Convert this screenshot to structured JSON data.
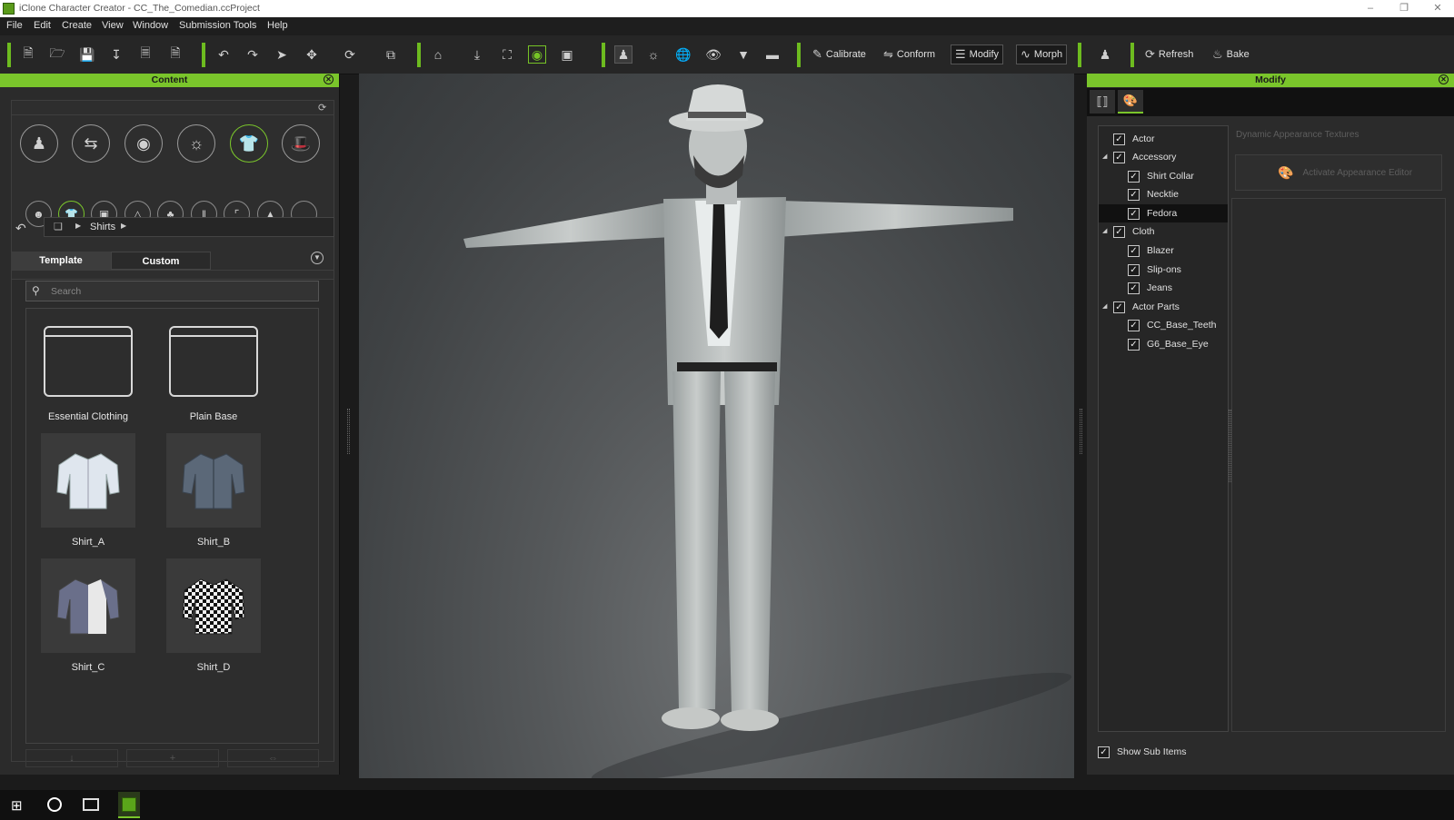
{
  "window": {
    "title": "iClone Character Creator - CC_The_Comedian.ccProject"
  },
  "menu": [
    "File",
    "Edit",
    "Create",
    "View",
    "Window",
    "Submission Tools",
    "Help"
  ],
  "toolbar": {
    "calibrate": "Calibrate",
    "conform": "Conform",
    "modify": "Modify",
    "morph": "Morph",
    "refresh": "Refresh",
    "bake": "Bake"
  },
  "content": {
    "title": "Content",
    "breadcrumb": "Shirts",
    "tabs": [
      "Template",
      "Custom"
    ],
    "search_placeholder": "Search",
    "items": [
      {
        "label": "Essential Clothing",
        "type": "folder"
      },
      {
        "label": "Plain Base",
        "type": "folder"
      },
      {
        "label": "Shirt_A",
        "type": "shirt"
      },
      {
        "label": "Shirt_B",
        "type": "shirt"
      },
      {
        "label": "Shirt_C",
        "type": "shirt"
      },
      {
        "label": "Shirt_D",
        "type": "shirt"
      }
    ]
  },
  "modify": {
    "title": "Modify",
    "tree": [
      {
        "label": "Actor",
        "level": 0,
        "checked": true
      },
      {
        "label": "Accessory",
        "level": 0,
        "checked": true,
        "expand": true
      },
      {
        "label": "Shirt Collar",
        "level": 1,
        "checked": true
      },
      {
        "label": "Necktie",
        "level": 1,
        "checked": true
      },
      {
        "label": "Fedora",
        "level": 1,
        "checked": true,
        "selected": true
      },
      {
        "label": "Cloth",
        "level": 0,
        "checked": true,
        "expand": true
      },
      {
        "label": "Blazer",
        "level": 1,
        "checked": true
      },
      {
        "label": "Slip-ons",
        "level": 1,
        "checked": true
      },
      {
        "label": "Jeans",
        "level": 1,
        "checked": true
      },
      {
        "label": "Actor Parts",
        "level": 0,
        "checked": true,
        "expand": true
      },
      {
        "label": "CC_Base_Teeth",
        "level": 1,
        "checked": true
      },
      {
        "label": "G6_Base_Eye",
        "level": 1,
        "checked": true
      }
    ],
    "dynamic_label": "Dynamic Appearance Textures",
    "activate_btn": "Activate Appearance Editor",
    "show_sub_items": "Show Sub Items"
  },
  "colors": {
    "accent": "#7ac52b",
    "panel": "#2b2b2b",
    "viewport": "#4a4d4f"
  }
}
